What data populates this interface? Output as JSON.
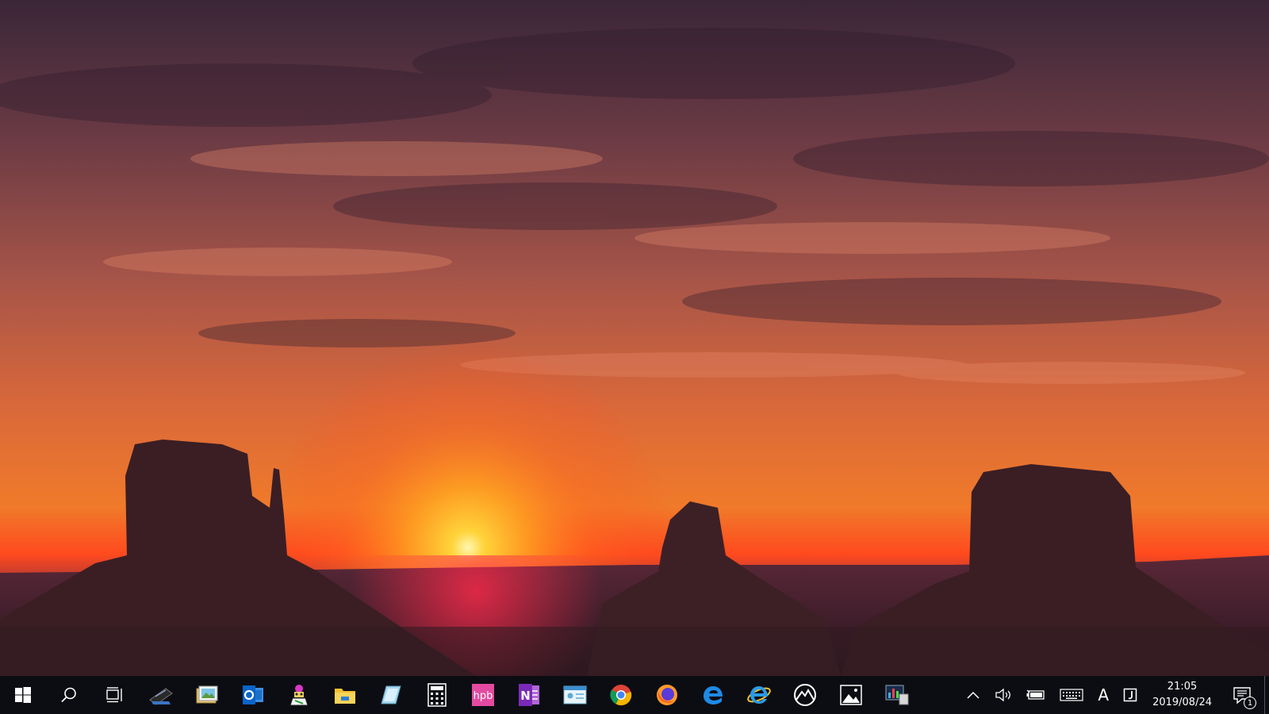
{
  "taskbar": {
    "start_icon": "windows-logo-icon",
    "search_icon": "search-icon",
    "task_view_icon": "task-view-icon",
    "pinned_apps": [
      {
        "name": "scanner",
        "icon": "scanner-icon"
      },
      {
        "name": "photo-viewer",
        "icon": "photo-viewer-icon"
      },
      {
        "name": "outlook",
        "icon": "outlook-icon"
      },
      {
        "name": "paint-character",
        "icon": "character-icon"
      },
      {
        "name": "file-explorer",
        "icon": "folder-icon"
      },
      {
        "name": "notes",
        "icon": "glass-notebook-icon"
      },
      {
        "name": "calculator",
        "icon": "calculator-icon"
      },
      {
        "name": "hpb",
        "icon": "hpb-icon",
        "label": "hpb"
      },
      {
        "name": "onenote",
        "icon": "onenote-icon",
        "label": "N"
      },
      {
        "name": "contact-card",
        "icon": "id-card-icon"
      },
      {
        "name": "chrome",
        "icon": "chrome-icon"
      },
      {
        "name": "firefox",
        "icon": "firefox-icon"
      },
      {
        "name": "edge",
        "icon": "edge-icon"
      },
      {
        "name": "internet-explorer",
        "icon": "internet-explorer-icon"
      },
      {
        "name": "mountain-app",
        "icon": "mountain-circle-icon"
      },
      {
        "name": "photos",
        "icon": "photos-icon"
      },
      {
        "name": "monitor-app",
        "icon": "resource-monitor-icon"
      }
    ]
  },
  "tray": {
    "chevron_icon": "chevron-up-icon",
    "volume_icon": "volume-icon",
    "battery_icon": "battery-icon",
    "keyboard_icon": "keyboard-icon",
    "ime_label": "A",
    "ime_mode_icon": "ime-mode-icon",
    "clock": {
      "time": "21:05",
      "date": "2019/08/24"
    },
    "notification_icon": "action-center-icon",
    "notification_count": "1"
  },
  "colors": {
    "taskbar_bg": "#0c0d12",
    "sky_top": "#3b2a3a",
    "sky_mid": "#c4604a",
    "sun": "#ffd43a",
    "horizon": "#ff3b1f",
    "butte": "#3a1e22"
  }
}
